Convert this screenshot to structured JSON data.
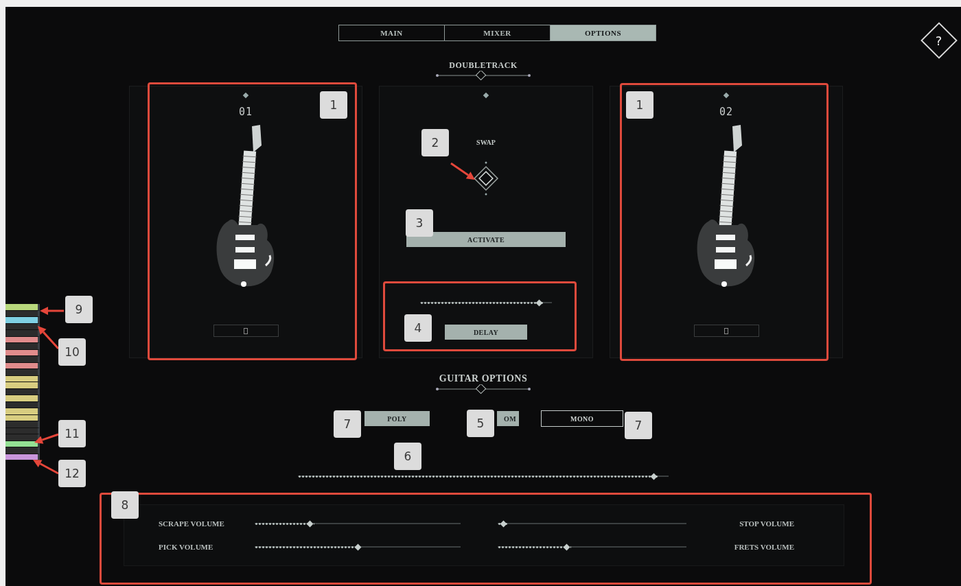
{
  "tabs": [
    {
      "label": "MAIN",
      "selected": false
    },
    {
      "label": "MIXER",
      "selected": false
    },
    {
      "label": "OPTIONS",
      "selected": true
    }
  ],
  "help": {
    "label": "?"
  },
  "doubletrack": {
    "title": "DOUBLETRACK",
    "slots": [
      {
        "number": "01"
      },
      {
        "number": "02"
      }
    ],
    "swap_label": "SWAP",
    "activate": {
      "label": "ACTIVATE"
    },
    "delay": {
      "label": "DELAY",
      "level": 0.93
    }
  },
  "guitar_options": {
    "title": "GUITAR OPTIONS",
    "modes": [
      {
        "label": "POLY",
        "on": true
      },
      {
        "label": "OM",
        "on": true
      },
      {
        "label": "MONO",
        "on": false
      }
    ],
    "level": 0.97
  },
  "volume_rows": [
    {
      "controls": [
        {
          "label": "SCRAPE VOLUME",
          "level": 0.26
        },
        {
          "label": "STOP VOLUME",
          "level": 0.01
        }
      ]
    },
    {
      "controls": [
        {
          "label": "PICK VOLUME",
          "level": 0.5
        },
        {
          "label": "FRETS VOLUME",
          "level": 0.36
        }
      ]
    }
  ],
  "keyboard": {
    "keys": [
      {
        "color": "#b8d87c"
      },
      {
        "color": "#2c2c2c"
      },
      {
        "color": "#7fd0e3"
      },
      {
        "color": "#2c2c2c"
      },
      {
        "color": "#2c2c2c"
      },
      {
        "color": "#e08c8c"
      },
      {
        "color": "#2c2c2c"
      },
      {
        "color": "#e08c8c"
      },
      {
        "color": "#2c2c2c"
      },
      {
        "color": "#e08c8c"
      },
      {
        "color": "#2c2c2c"
      },
      {
        "color": "#d8cd80"
      },
      {
        "color": "#d8cd80"
      },
      {
        "color": "#2c2c2c"
      },
      {
        "color": "#d8cd80"
      },
      {
        "color": "#2c2c2c"
      },
      {
        "color": "#d8cd80"
      },
      {
        "color": "#d8cd80"
      },
      {
        "color": "#2c2c2c"
      },
      {
        "color": "#2c2c2c"
      },
      {
        "color": "#2c2c2c"
      },
      {
        "color": "#94e094"
      },
      {
        "color": "#2c2c2c"
      },
      {
        "color": "#c996dc"
      }
    ]
  },
  "callouts": [
    "1",
    "1",
    "2",
    "3",
    "9",
    "4",
    "10",
    "7",
    "5",
    "7",
    "11",
    "6",
    "12",
    "8"
  ]
}
